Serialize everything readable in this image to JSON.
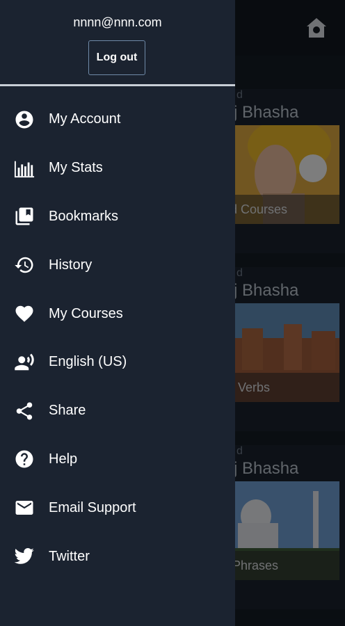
{
  "header": {
    "email": "nnnn@nnn.com",
    "logout_label": "Log out"
  },
  "menu": {
    "items": [
      {
        "label": "My Account",
        "icon": "account-circle-icon"
      },
      {
        "label": "My Stats",
        "icon": "bar-chart-icon"
      },
      {
        "label": "Bookmarks",
        "icon": "bookmarks-icon"
      },
      {
        "label": "History",
        "icon": "history-icon"
      },
      {
        "label": "My Courses",
        "icon": "heart-icon"
      },
      {
        "label": "English (US)",
        "icon": "voice-language-icon"
      },
      {
        "label": "Share",
        "icon": "share-icon"
      },
      {
        "label": "Help",
        "icon": "help-icon"
      },
      {
        "label": "Email Support",
        "icon": "email-icon"
      },
      {
        "label": "Twitter",
        "icon": "twitter-icon"
      }
    ]
  },
  "background": {
    "cards": [
      {
        "sub": "d",
        "title": "j Bhasha",
        "caption": "alized Courses"
      },
      {
        "sub": "d",
        "title": "j Bhasha",
        "caption": "ential Verbs"
      },
      {
        "sub": "d",
        "title": "j Bhasha",
        "caption": "erful Phrases"
      }
    ]
  },
  "colors": {
    "drawer_bg": "#1b2330",
    "logout_border": "#6f8aa8",
    "text": "#ffffff"
  }
}
